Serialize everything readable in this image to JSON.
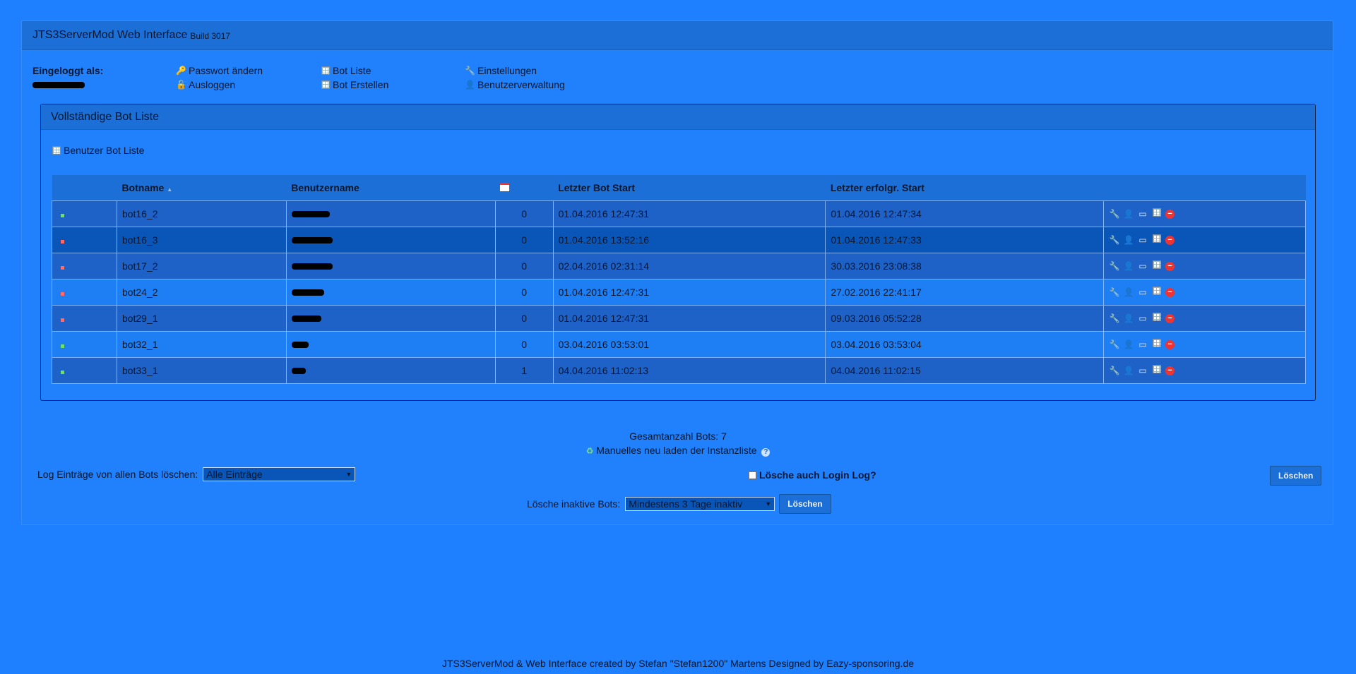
{
  "header": {
    "title": "JTS3ServerMod Web Interface",
    "build": "Build 3017"
  },
  "userbar": {
    "logged_in_label": "Eingeloggt als:",
    "links": {
      "change_password": "Passwort ändern",
      "logout": "Ausloggen",
      "bot_list": "Bot Liste",
      "create_bot": "Bot Erstellen",
      "settings": "Einstellungen",
      "user_management": "Benutzerverwaltung"
    }
  },
  "botlist": {
    "title": "Vollständige Bot Liste",
    "user_bot_list_link": "Benutzer Bot Liste",
    "columns": {
      "botname": "Botname",
      "sort_indicator": "▲",
      "username": "Benutzername",
      "last_start": "Letzter Bot Start",
      "last_success_start": "Letzter erfolgr. Start"
    },
    "rows": [
      {
        "status": "green",
        "botname": "bot16_2",
        "count": "0",
        "last_start": "01.04.2016 12:47:31",
        "last_success": "01.04.2016 12:47:34"
      },
      {
        "status": "red",
        "botname": "bot16_3",
        "count": "0",
        "last_start": "01.04.2016 13:52:16",
        "last_success": "01.04.2016 12:47:33"
      },
      {
        "status": "red",
        "botname": "bot17_2",
        "count": "0",
        "last_start": "02.04.2016 02:31:14",
        "last_success": "30.03.2016 23:08:38"
      },
      {
        "status": "red",
        "botname": "bot24_2",
        "count": "0",
        "last_start": "01.04.2016 12:47:31",
        "last_success": "27.02.2016 22:41:17"
      },
      {
        "status": "red",
        "botname": "bot29_1",
        "count": "0",
        "last_start": "01.04.2016 12:47:31",
        "last_success": "09.03.2016 05:52:28"
      },
      {
        "status": "green",
        "botname": "bot32_1",
        "count": "0",
        "last_start": "03.04.2016 03:53:01",
        "last_success": "03.04.2016 03:53:04"
      },
      {
        "status": "green",
        "botname": "bot33_1",
        "count": "1",
        "last_start": "04.04.2016 11:02:13",
        "last_success": "04.04.2016 11:02:15"
      }
    ]
  },
  "summary": {
    "total_bots": "Gesamtanzahl Bots: 7",
    "reload_link": "Manuelles neu laden der Instanzliste",
    "help": "?"
  },
  "log_delete": {
    "label": "Log Einträge von allen Bots löschen:",
    "selected": "Alle Einträge",
    "checkbox_label": "Lösche auch Login Log?",
    "button": "Löschen"
  },
  "inactive_delete": {
    "label": "Lösche inaktive Bots:",
    "selected": "Mindestens 3 Tage inaktiv",
    "button": "Löschen"
  },
  "footer": "JTS3ServerMod & Web Interface created by Stefan \"Stefan1200\" Martens Designed by Eazy-sponsoring.de",
  "colors": {
    "background": "#1e7fff",
    "header": "#1b6fd6",
    "status_green": "#6fe06f",
    "status_red": "#ff6a6a"
  }
}
